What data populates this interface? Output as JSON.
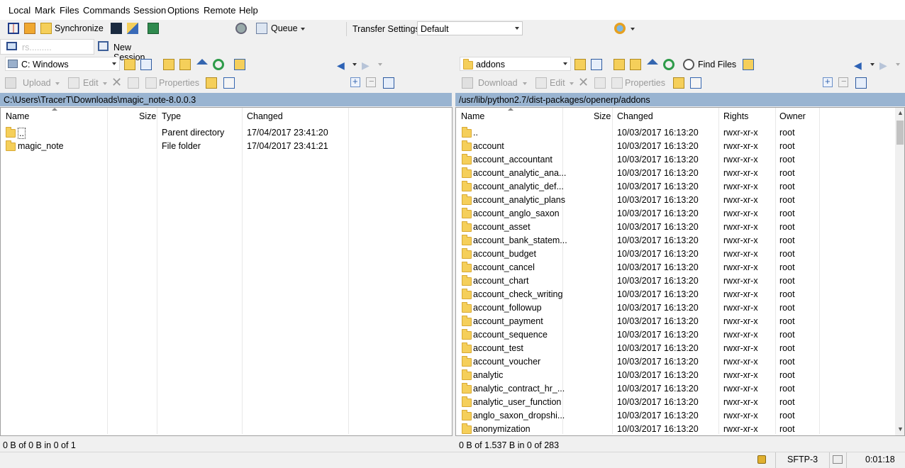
{
  "menu": [
    "Local",
    "Mark",
    "Files",
    "Commands",
    "Session",
    "Options",
    "Remote",
    "Help"
  ],
  "toolbar": {
    "synchronize_label": "Synchronize",
    "queue_label": "Queue",
    "transfer_settings_label": "Transfer Settings",
    "transfer_settings_value": "Default"
  },
  "session_tabs": {
    "current_session": "rs.........",
    "new_session_label": "New Session"
  },
  "local": {
    "drive": "C: Windows",
    "upload_label": "Upload",
    "edit_label": "Edit",
    "properties_label": "Properties",
    "path": "C:\\Users\\TracerT\\Downloads\\magic_note-8.0.0.3",
    "columns": [
      "Name",
      "Size",
      "Type",
      "Changed"
    ],
    "rows": [
      {
        "name": "..",
        "size": "",
        "type": "Parent directory",
        "changed": "17/04/2017  23:41:20"
      },
      {
        "name": "magic_note",
        "size": "",
        "type": "File folder",
        "changed": "17/04/2017  23:41:21"
      }
    ],
    "status": "0 B of 0 B in 0 of 1"
  },
  "remote": {
    "dir": "addons",
    "find_files_label": "Find Files",
    "download_label": "Download",
    "edit_label": "Edit",
    "properties_label": "Properties",
    "path": "/usr/lib/python2.7/dist-packages/openerp/addons",
    "columns": [
      "Name",
      "Size",
      "Changed",
      "Rights",
      "Owner"
    ],
    "rows": [
      {
        "name": "..",
        "changed": "10/03/2017 16:13:20",
        "rights": "rwxr-xr-x",
        "owner": "root"
      },
      {
        "name": "account",
        "changed": "10/03/2017 16:13:20",
        "rights": "rwxr-xr-x",
        "owner": "root"
      },
      {
        "name": "account_accountant",
        "changed": "10/03/2017 16:13:20",
        "rights": "rwxr-xr-x",
        "owner": "root"
      },
      {
        "name": "account_analytic_ana...",
        "changed": "10/03/2017 16:13:20",
        "rights": "rwxr-xr-x",
        "owner": "root"
      },
      {
        "name": "account_analytic_def...",
        "changed": "10/03/2017 16:13:20",
        "rights": "rwxr-xr-x",
        "owner": "root"
      },
      {
        "name": "account_analytic_plans",
        "changed": "10/03/2017 16:13:20",
        "rights": "rwxr-xr-x",
        "owner": "root"
      },
      {
        "name": "account_anglo_saxon",
        "changed": "10/03/2017 16:13:20",
        "rights": "rwxr-xr-x",
        "owner": "root"
      },
      {
        "name": "account_asset",
        "changed": "10/03/2017 16:13:20",
        "rights": "rwxr-xr-x",
        "owner": "root"
      },
      {
        "name": "account_bank_statem...",
        "changed": "10/03/2017 16:13:20",
        "rights": "rwxr-xr-x",
        "owner": "root"
      },
      {
        "name": "account_budget",
        "changed": "10/03/2017 16:13:20",
        "rights": "rwxr-xr-x",
        "owner": "root"
      },
      {
        "name": "account_cancel",
        "changed": "10/03/2017 16:13:20",
        "rights": "rwxr-xr-x",
        "owner": "root"
      },
      {
        "name": "account_chart",
        "changed": "10/03/2017 16:13:20",
        "rights": "rwxr-xr-x",
        "owner": "root"
      },
      {
        "name": "account_check_writing",
        "changed": "10/03/2017 16:13:20",
        "rights": "rwxr-xr-x",
        "owner": "root"
      },
      {
        "name": "account_followup",
        "changed": "10/03/2017 16:13:20",
        "rights": "rwxr-xr-x",
        "owner": "root"
      },
      {
        "name": "account_payment",
        "changed": "10/03/2017 16:13:20",
        "rights": "rwxr-xr-x",
        "owner": "root"
      },
      {
        "name": "account_sequence",
        "changed": "10/03/2017 16:13:20",
        "rights": "rwxr-xr-x",
        "owner": "root"
      },
      {
        "name": "account_test",
        "changed": "10/03/2017 16:13:20",
        "rights": "rwxr-xr-x",
        "owner": "root"
      },
      {
        "name": "account_voucher",
        "changed": "10/03/2017 16:13:20",
        "rights": "rwxr-xr-x",
        "owner": "root"
      },
      {
        "name": "analytic",
        "changed": "10/03/2017 16:13:20",
        "rights": "rwxr-xr-x",
        "owner": "root"
      },
      {
        "name": "analytic_contract_hr_...",
        "changed": "10/03/2017 16:13:20",
        "rights": "rwxr-xr-x",
        "owner": "root"
      },
      {
        "name": "analytic_user_function",
        "changed": "10/03/2017 16:13:20",
        "rights": "rwxr-xr-x",
        "owner": "root"
      },
      {
        "name": "anglo_saxon_dropshi...",
        "changed": "10/03/2017 16:13:20",
        "rights": "rwxr-xr-x",
        "owner": "root"
      },
      {
        "name": "anonymization",
        "changed": "10/03/2017 16:13:20",
        "rights": "rwxr-xr-x",
        "owner": "root"
      }
    ],
    "status": "0 B of 1.537 B in 0 of 283"
  },
  "statusbar": {
    "protocol": "SFTP-3",
    "elapsed": "0:01:18"
  },
  "colors": {
    "path_bar": "#99b4d1",
    "folder": "#f5cf5a"
  }
}
